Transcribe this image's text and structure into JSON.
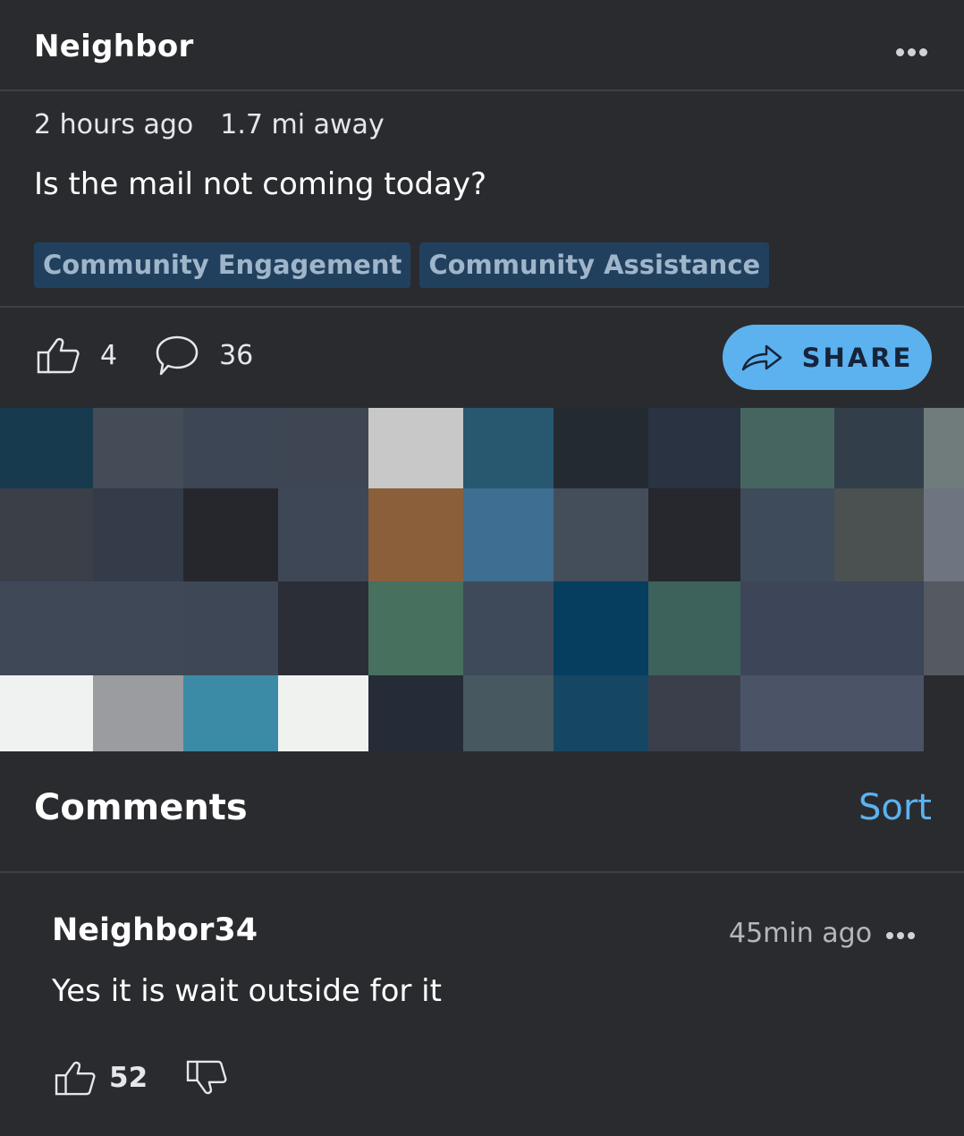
{
  "post": {
    "author": "Neighbor",
    "time_ago": "2 hours ago",
    "distance": "1.7 mi away",
    "text": "Is the mail not coming today?",
    "tags": [
      "Community Engagement",
      "Community Assistance"
    ],
    "likes": "4",
    "comments_count": "36",
    "share_label": "SHARE"
  },
  "image": {
    "description_icon": "pixelated-image",
    "mosaic_colors": [
      [
        "#183a4f",
        "#434c57",
        "#3d4654",
        "#3d4652",
        "#c8c8c8",
        "#285870",
        "#242a31",
        "#293342",
        "#466560",
        "#323e4a",
        "#707c7c"
      ],
      [
        "#3b3f48",
        "#343b49",
        "#26272c",
        "#3e4756",
        "#8a5f3a",
        "#3e6e91",
        "#444e5b",
        "#27272e",
        "#3e4b5b",
        "#4b5051",
        "#6e7581"
      ],
      [
        "#3e4857",
        "#3e4857",
        "#3e4755",
        "#2b2e37",
        "#47705f",
        "#3e4a59",
        "#053e5f",
        "#3d625b",
        "#3c4658",
        "#3c4658",
        "#555a62"
      ],
      [
        "#f0f1f1",
        "#9b9c9f",
        "#3c8ba6",
        "#f0f2f0",
        "#252b37",
        "#475861",
        "#154763",
        "#3b3f4b",
        "#4a5466",
        "#4a5466",
        "#2a2b2f"
      ]
    ]
  },
  "comments": {
    "title": "Comments",
    "sort_label": "Sort",
    "items": [
      {
        "author": "Neighbor34",
        "time_ago": "45min ago",
        "text": "Yes it is wait outside for it",
        "likes": "52"
      }
    ]
  },
  "colors": {
    "background": "#2a2b2f",
    "accent": "#5cb2ef",
    "tag_bg": "#21405e",
    "tag_text": "#9fb5ca"
  }
}
